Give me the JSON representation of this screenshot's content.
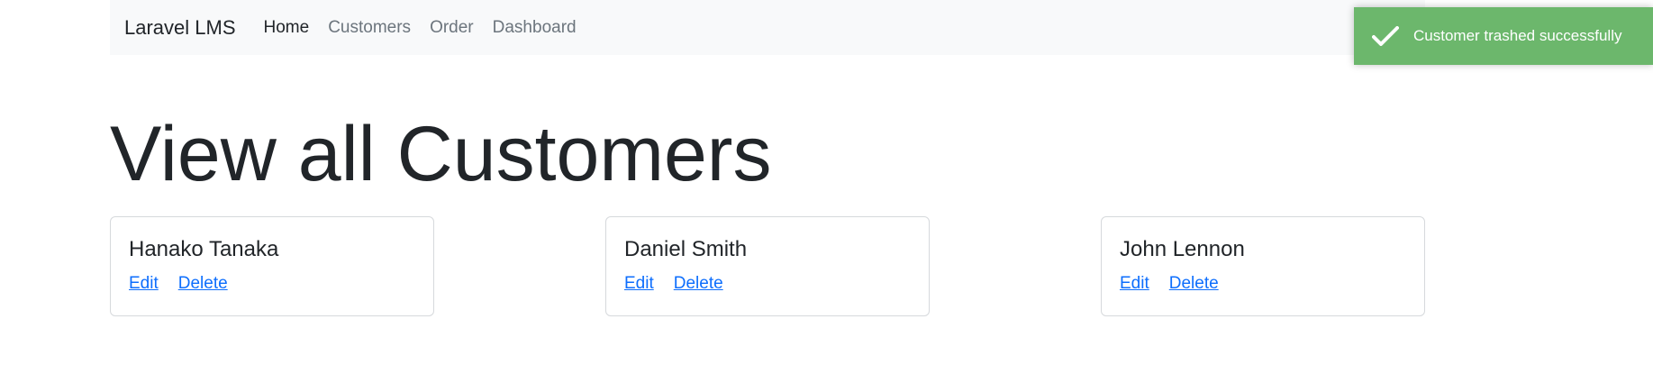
{
  "navbar": {
    "brand": "Laravel LMS",
    "links": [
      {
        "label": "Home",
        "active": true
      },
      {
        "label": "Customers",
        "active": false
      },
      {
        "label": "Order",
        "active": false
      },
      {
        "label": "Dashboard",
        "active": false
      }
    ]
  },
  "page": {
    "title": "View all Customers"
  },
  "customers": [
    {
      "name": "Hanako Tanaka",
      "edit_label": "Edit",
      "delete_label": "Delete"
    },
    {
      "name": "Daniel Smith",
      "edit_label": "Edit",
      "delete_label": "Delete"
    },
    {
      "name": "John Lennon",
      "edit_label": "Edit",
      "delete_label": "Delete"
    }
  ],
  "toast": {
    "message": "Customer trashed successfully",
    "icon": "check-icon",
    "color": "#6cb76c"
  },
  "colors": {
    "link": "#0d6efd",
    "navbar_bg": "#f8f9fa"
  }
}
